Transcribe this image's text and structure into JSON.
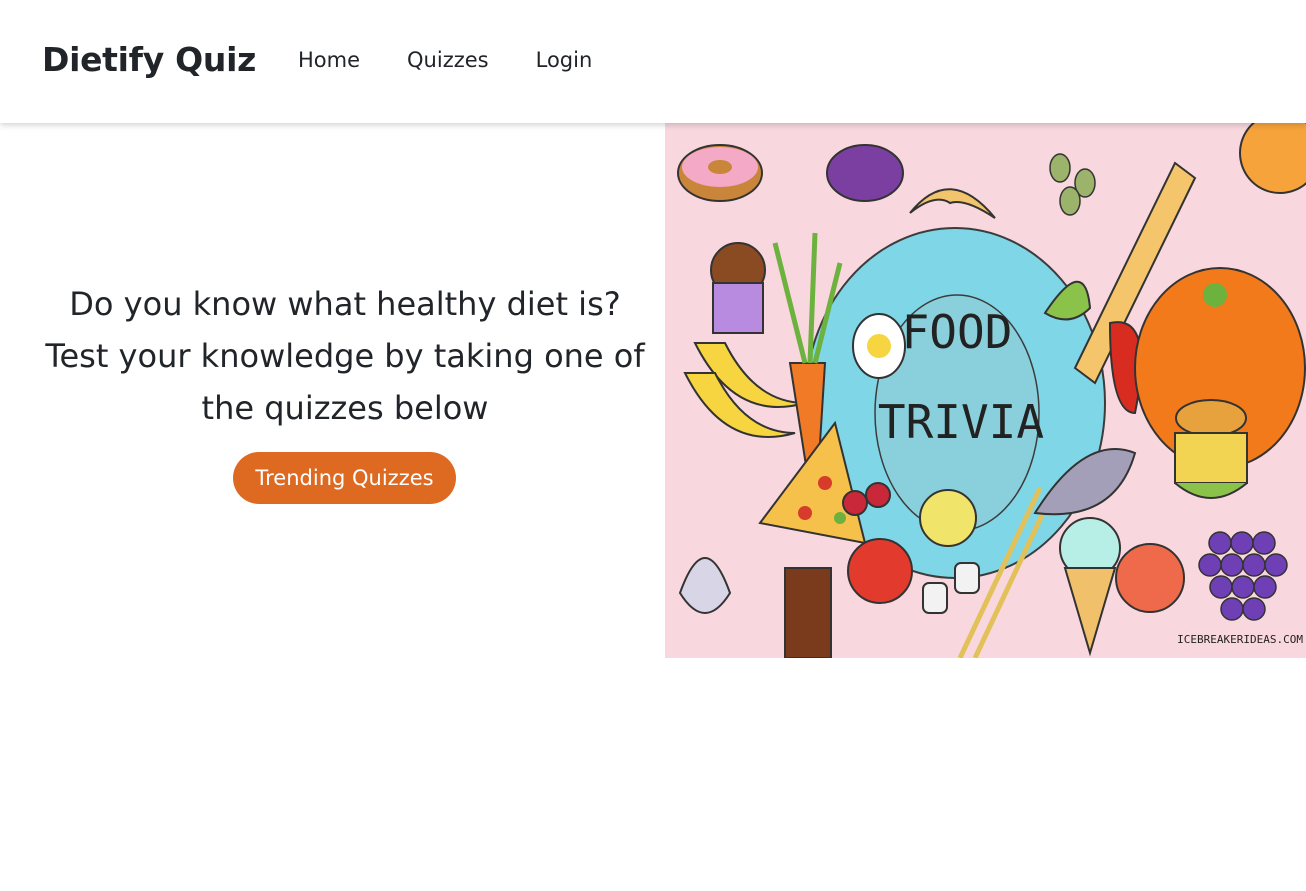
{
  "navbar": {
    "brand": "Dietify Quiz",
    "links": [
      {
        "label": "Home"
      },
      {
        "label": "Quizzes"
      },
      {
        "label": "Login"
      }
    ]
  },
  "hero": {
    "heading_line1": "Do you know what healthy diet is?",
    "heading_line2": "Test your knowledge by taking one of",
    "heading_line3": "the quizzes below",
    "button_label": "Trending Quizzes",
    "button_color": "#de6a22"
  },
  "image": {
    "title_line1": "FOOD",
    "title_line2": "TRIVIA",
    "watermark": "ICEBREAKERIDEAS.COM",
    "background_color": "#f9d7de",
    "plate_color": "#7fd6e6"
  }
}
